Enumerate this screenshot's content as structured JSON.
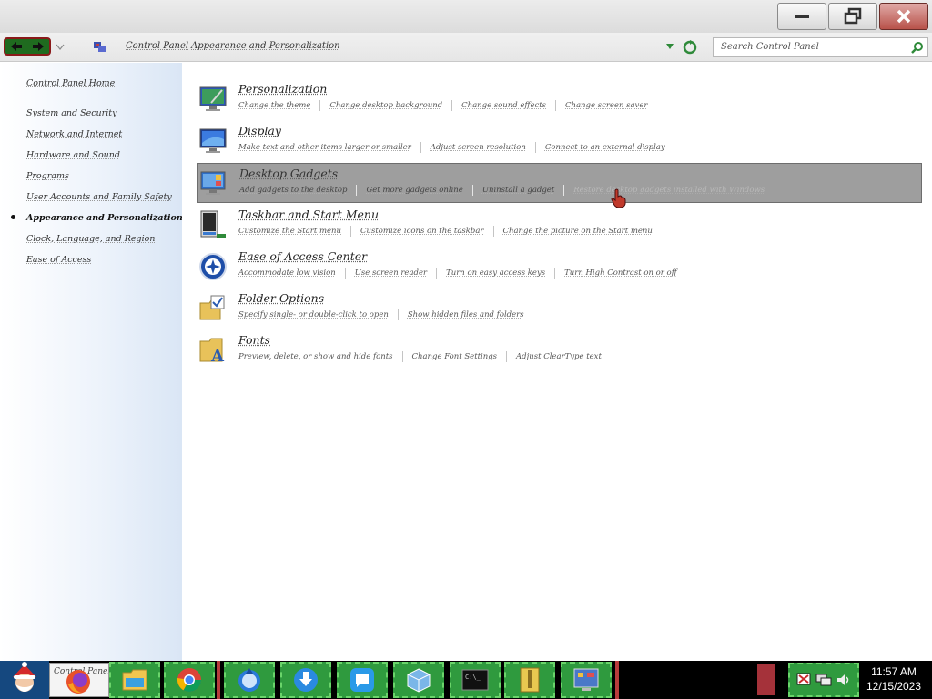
{
  "window": {
    "buttons": {
      "minimize": "minimize",
      "maximize": "restore",
      "close": "close"
    }
  },
  "navbar": {
    "breadcrumb": [
      "Control Panel",
      "Appearance and Personalization"
    ],
    "search_placeholder": "Search Control Panel"
  },
  "sidebar": {
    "items": [
      {
        "label": "Control Panel Home",
        "active": false
      },
      {
        "label": "System and Security",
        "active": false
      },
      {
        "label": "Network and Internet",
        "active": false
      },
      {
        "label": "Hardware and Sound",
        "active": false
      },
      {
        "label": "Programs",
        "active": false
      },
      {
        "label": "User Accounts and Family Safety",
        "active": false
      },
      {
        "label": "Appearance and Personalization",
        "active": true
      },
      {
        "label": "Clock, Language, and Region",
        "active": false
      },
      {
        "label": "Ease of Access",
        "active": false
      }
    ]
  },
  "categories": [
    {
      "title": "Personalization",
      "icon": "personalization-icon",
      "links": [
        "Change the theme",
        "Change desktop background",
        "Change sound effects",
        "Change screen saver"
      ]
    },
    {
      "title": "Display",
      "icon": "display-icon",
      "links": [
        "Make text and other items larger or smaller",
        "Adjust screen resolution",
        "Connect to an external display"
      ]
    },
    {
      "title": "Desktop Gadgets",
      "icon": "desktop-gadgets-icon",
      "hovered": true,
      "links": [
        "Add gadgets to the desktop",
        "Get more gadgets online",
        "Uninstall a gadget",
        "Restore desktop gadgets installed with Windows"
      ]
    },
    {
      "title": "Taskbar and Start Menu",
      "icon": "taskbar-icon",
      "links": [
        "Customize the Start menu",
        "Customize icons on the taskbar",
        "Change the picture on the Start menu"
      ]
    },
    {
      "title": "Ease of Access Center",
      "icon": "ease-of-access-icon",
      "links": [
        "Accommodate low vision",
        "Use screen reader",
        "Turn on easy access keys",
        "Turn High Contrast on or off"
      ]
    },
    {
      "title": "Folder Options",
      "icon": "folder-options-icon",
      "links": [
        "Specify single- or double-click to open",
        "Show hidden files and folders"
      ]
    },
    {
      "title": "Fonts",
      "icon": "fonts-icon",
      "links": [
        "Preview, delete, or show and hide fonts",
        "Change Font Settings",
        "Adjust ClearType text"
      ]
    }
  ],
  "taskbar": {
    "open_window_label": "Control Panel",
    "apps": [
      "file-explorer-icon",
      "chrome-icon",
      "app-globe-icon",
      "download-icon",
      "chat-icon",
      "package-icon",
      "terminal-icon",
      "archive-icon",
      "control-panel-icon"
    ],
    "clock_time": "11:57 AM",
    "clock_date": "12/15/2023"
  },
  "colors": {
    "hover_bg": "#9e9e9e",
    "taskbar_app": "#2f9a3e",
    "nav_button": "#1f6b1f"
  }
}
